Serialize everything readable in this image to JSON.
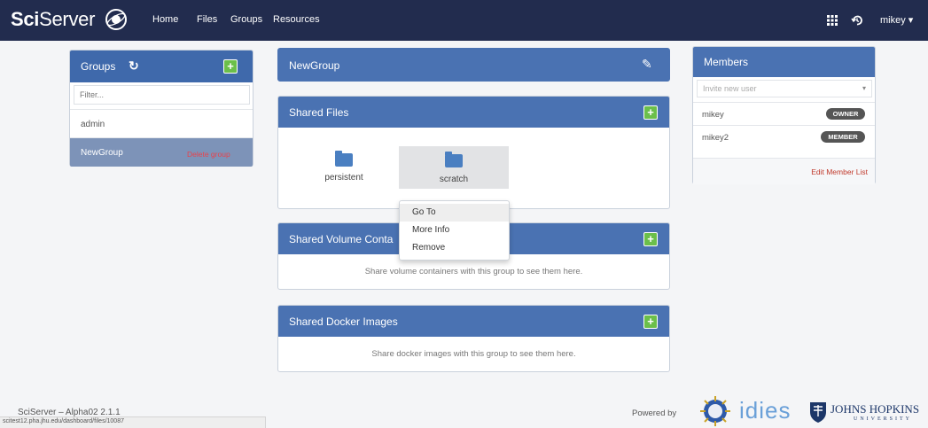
{
  "navbar": {
    "brand_bold": "Sci",
    "brand_rest": "Server",
    "links": [
      "Home",
      "Files",
      "Groups",
      "Resources"
    ],
    "user": "mikey",
    "user_caret": "▾"
  },
  "groups_panel": {
    "title": "Groups",
    "refresh_icon": "↻",
    "add_label": "+",
    "filter_placeholder": "Filter...",
    "items": [
      {
        "name": "admin"
      },
      {
        "name": "NewGroup",
        "action": "Delete group"
      }
    ]
  },
  "group_header": {
    "title": "NewGroup",
    "edit_icon": "✎"
  },
  "shared_files": {
    "title": "Shared Files",
    "add_label": "+",
    "folders": [
      "persistent",
      "scratch"
    ]
  },
  "context_menu": {
    "items": [
      "Go To",
      "More Info",
      "Remove"
    ]
  },
  "shared_volumes": {
    "title": "Shared Volume Conta",
    "add_label": "+",
    "empty_text": "Share volume containers with this group to see them here."
  },
  "shared_docker": {
    "title": "Shared Docker Images",
    "add_label": "+",
    "empty_text": "Share docker images with this group to see them here."
  },
  "members_panel": {
    "title": "Members",
    "invite_placeholder": "Invite new user",
    "invite_caret": "▾",
    "members": [
      {
        "name": "mikey",
        "role": "OWNER"
      },
      {
        "name": "mikey2",
        "role": "MEMBER"
      }
    ],
    "edit_link": "Edit Member List"
  },
  "footer": {
    "version": "SciServer – Alpha02 2.1.1",
    "status_url": "scitest12.pha.jhu.edu/dashboard/files/10087",
    "powered_by": "Powered by",
    "idies": "idies",
    "jhu_line1": "JOHNS HOPKINS",
    "jhu_line2": "UNIVERSITY"
  },
  "colors": {
    "navbar": "#222c4e",
    "panel_header": "#4a72b2",
    "add_button": "#6bbf4a",
    "folder": "#4a7fc1"
  }
}
